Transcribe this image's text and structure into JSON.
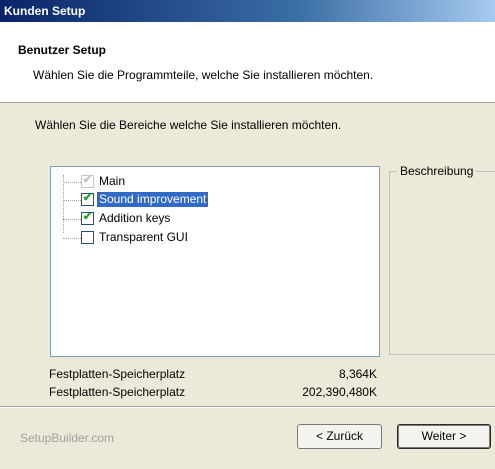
{
  "window": {
    "title": "Kunden Setup"
  },
  "header": {
    "title": "Benutzer Setup",
    "subtitle": "Wählen Sie die Programmteile, welche Sie installieren möchten."
  },
  "instruction": "Wählen Sie die Bereiche welche Sie installieren möchten.",
  "components": [
    {
      "label": "Main",
      "checked": true,
      "disabled": true,
      "selected": false
    },
    {
      "label": "Sound improvement",
      "checked": true,
      "disabled": false,
      "selected": true
    },
    {
      "label": "Addition keys",
      "checked": true,
      "disabled": false,
      "selected": false
    },
    {
      "label": "Transparent GUI",
      "checked": false,
      "disabled": false,
      "selected": false
    }
  ],
  "description": {
    "legend": "Beschreibung"
  },
  "disk_space": [
    {
      "label": "Festplatten-Speicherplatz",
      "value": "8,364K"
    },
    {
      "label": "Festplatten-Speicherplatz",
      "value": "202,390,480K"
    }
  ],
  "footer": {
    "brand": "SetupBuilder.com",
    "back_label": "< Zurück",
    "next_label": "Weiter >"
  },
  "check_glyph": "✔",
  "colors": {
    "selection": "#316ac5",
    "check": "#21a121"
  }
}
